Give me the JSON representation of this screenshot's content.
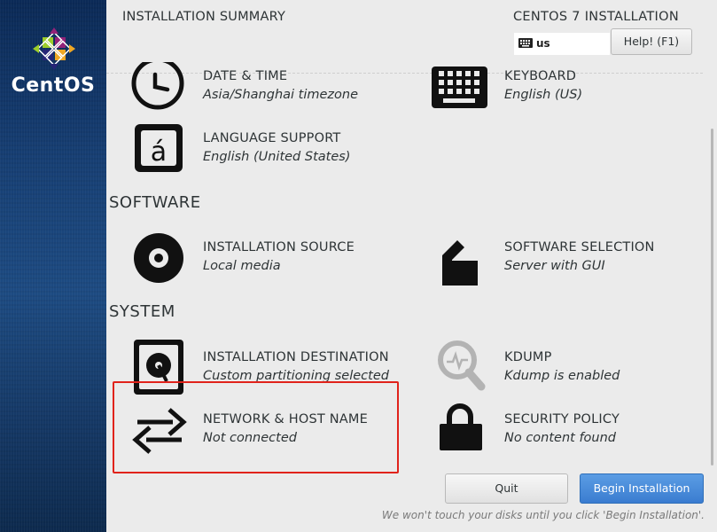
{
  "brand": {
    "name": "CentOS",
    "logo_icon": "centos-logo-icon"
  },
  "header": {
    "title": "INSTALLATION SUMMARY",
    "product": "CENTOS 7 INSTALLATION",
    "keyboard_layout": "us",
    "help_label": "Help! (F1)"
  },
  "localization": {
    "items": [
      {
        "title": "DATE & TIME",
        "status": "Asia/Shanghai timezone",
        "icon": "clock-icon"
      },
      {
        "title": "KEYBOARD",
        "status": "English (US)",
        "icon": "keyboard-icon"
      },
      {
        "title": "LANGUAGE SUPPORT",
        "status": "English (United States)",
        "icon": "language-icon"
      }
    ]
  },
  "software": {
    "heading": "SOFTWARE",
    "items": [
      {
        "title": "INSTALLATION SOURCE",
        "status": "Local media",
        "icon": "disc-icon"
      },
      {
        "title": "SOFTWARE SELECTION",
        "status": "Server with GUI",
        "icon": "package-icon"
      }
    ]
  },
  "system": {
    "heading": "SYSTEM",
    "items": [
      {
        "title": "INSTALLATION DESTINATION",
        "status": "Custom partitioning selected",
        "icon": "hard-drive-icon"
      },
      {
        "title": "KDUMP",
        "status": "Kdump is enabled",
        "icon": "magnifier-icon"
      },
      {
        "title": "NETWORK & HOST NAME",
        "status": "Not connected",
        "icon": "network-arrows-icon"
      },
      {
        "title": "SECURITY POLICY",
        "status": "No content found",
        "icon": "lock-icon"
      }
    ]
  },
  "footer": {
    "quit_label": "Quit",
    "begin_label": "Begin Installation",
    "note": "We won't touch your disks until you click 'Begin Installation'."
  },
  "colors": {
    "sidebar": "#173f74",
    "accent": "#3a7cd0",
    "highlight": "#e0231b",
    "background": "#ebebeb"
  }
}
